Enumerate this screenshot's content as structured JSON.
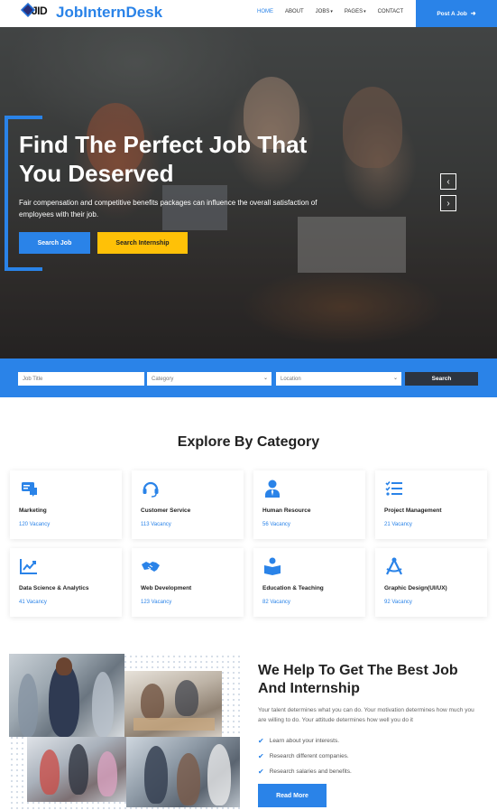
{
  "header": {
    "logo_mark": "JID",
    "logo_text": "JobInternDesk",
    "nav": [
      {
        "label": "HOME",
        "active": true
      },
      {
        "label": "ABOUT",
        "active": false
      },
      {
        "label": "JOBS",
        "dropdown": true
      },
      {
        "label": "PAGES",
        "dropdown": true
      },
      {
        "label": "CONTACT",
        "active": false
      }
    ],
    "post_job_label": "Post A Job",
    "colors": {
      "accent": "#2a83e8",
      "secondary": "#ffc107",
      "dark": "#2c3440"
    }
  },
  "hero": {
    "title": "Find The Perfect Job That You Deserved",
    "description": "Fair compensation and competitive benefits packages can influence the overall satisfaction of employees with their job.",
    "search_job_label": "Search Job",
    "search_internship_label": "Search Internship",
    "prev_icon": "chevron-left-icon",
    "next_icon": "chevron-right-icon"
  },
  "search": {
    "job_title_placeholder": "Job Title",
    "category_placeholder": "Category",
    "location_placeholder": "Location",
    "button_label": "Search"
  },
  "categories": {
    "title": "Explore By Category",
    "items": [
      {
        "name": "Marketing",
        "count": "120 Vacancy",
        "icon": "marketing-icon"
      },
      {
        "name": "Customer Service",
        "count": "113 Vacancy",
        "icon": "headset-icon"
      },
      {
        "name": "Human Resource",
        "count": "56 Vacancy",
        "icon": "user-tie-icon"
      },
      {
        "name": "Project Management",
        "count": "21 Vacancy",
        "icon": "task-list-icon"
      },
      {
        "name": "Data Science & Analytics",
        "count": "41 Vacancy",
        "icon": "chart-line-icon"
      },
      {
        "name": "Web Development",
        "count": "123 Vacancy",
        "icon": "handshake-icon"
      },
      {
        "name": "Education & Teaching",
        "count": "82 Vacancy",
        "icon": "book-reader-icon"
      },
      {
        "name": "Graphic Design(UI/UX)",
        "count": "92 Vacancy",
        "icon": "drafting-compass-icon"
      }
    ]
  },
  "about": {
    "title": "We Help To Get The Best Job And Internship",
    "description": "Your talent determines what you can do. Your motivation determines how much you are willing to do. Your attitude determines how well you do it",
    "checklist": [
      "Learn about your interests.",
      "Research different companies.",
      "Research salaries and benefits."
    ],
    "read_more_label": "Read More"
  }
}
